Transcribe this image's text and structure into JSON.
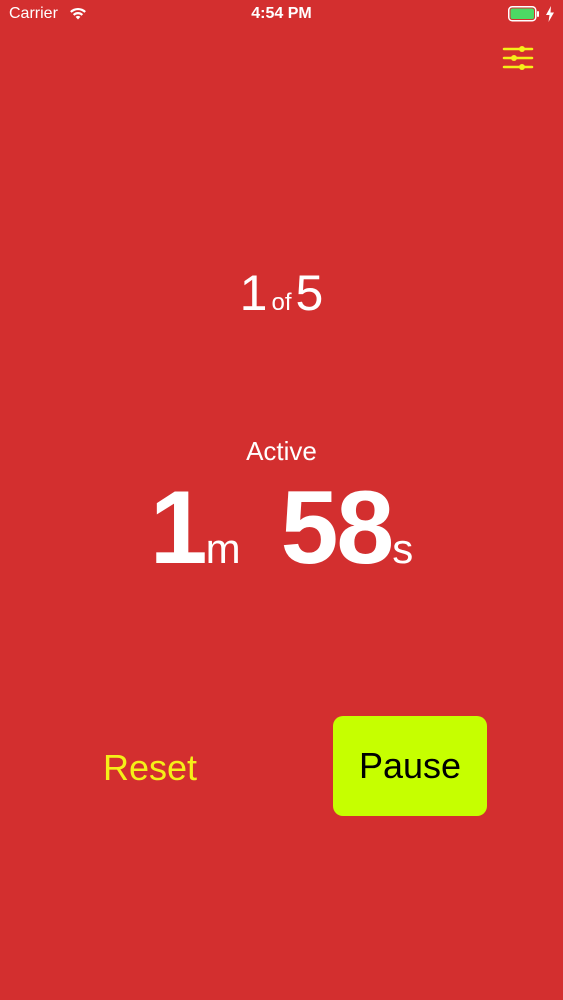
{
  "status_bar": {
    "carrier": "Carrier",
    "time": "4:54 PM",
    "battery_color": "#4cd964"
  },
  "header": {
    "settings_icon": "sliders-icon",
    "accent_color": "#f5ef18"
  },
  "rounds": {
    "current": "1",
    "separator": "of",
    "total": "5"
  },
  "phase": {
    "label": "Active"
  },
  "timer": {
    "minutes": "1",
    "minutes_unit": "m",
    "seconds": "58",
    "seconds_unit": "s"
  },
  "controls": {
    "reset_label": "Reset",
    "pause_label": "Pause",
    "pause_color": "#c6ff00"
  },
  "theme": {
    "background": "#d32f2f"
  }
}
